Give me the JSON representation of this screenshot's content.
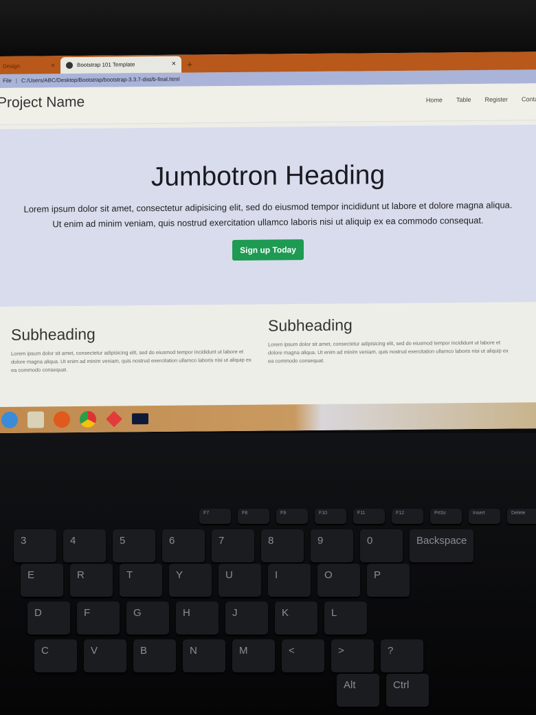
{
  "browser": {
    "tabs": [
      {
        "label": "Design",
        "active": false
      },
      {
        "label": "Bootstrap 101 Template",
        "active": true
      }
    ],
    "new_tab": "+",
    "close": "×",
    "address": {
      "scheme": "File",
      "url": "C:/Users/ABC/Desktop/Bootstrap/bootstrap-3.3.7-dist/b-final.html"
    }
  },
  "navbar": {
    "brand": "Project Name",
    "links": [
      "Home",
      "Table",
      "Register",
      "Contact"
    ]
  },
  "jumbotron": {
    "heading": "Jumbotron Heading",
    "text": "Lorem ipsum dolor sit amet, consectetur adipisicing elit, sed do eiusmod tempor incididunt ut labore et dolore magna aliqua. Ut enim ad minim veniam, quis nostrud exercitation ullamco laboris nisi ut aliquip ex ea commodo consequat.",
    "button": "Sign up Today",
    "button_color": "#1e9a52"
  },
  "sections": [
    {
      "heading": "Subheading",
      "text": "Lorem ipsum dolor sit amet, consectetur adipisicing elit, sed do eiusmod tempor incididunt ut labore et dolore magna aliqua. Ut enim ad minim veniam, quis nostrud exercitation ullamco laboris nisi ut aliquip ex ea commodo consequat."
    },
    {
      "heading": "Subheading",
      "text": "Lorem ipsum dolor sit amet, consectetur adipisicing elit, sed do eiusmod tempor incididunt ut labore et dolore magna aliqua. Ut enim ad minim veniam, quis nostrud exercitation ullamco laboris nisi ut aliquip ex ea commodo consequat."
    }
  ],
  "taskbar": {
    "icons": [
      "internet-explorer-icon",
      "file-explorer-icon",
      "firefox-icon",
      "chrome-icon",
      "app-icon",
      "command-prompt-icon"
    ]
  },
  "keyboard": {
    "fkeys": [
      "F7",
      "F8",
      "F9",
      "F10",
      "F11",
      "F12",
      "PrtSc",
      "Insert",
      "Delete"
    ],
    "row1": [
      "3",
      "4",
      "5",
      "6",
      "7",
      "8",
      "9",
      "0",
      "Backspace"
    ],
    "row2": [
      "E",
      "R",
      "T",
      "Y",
      "U",
      "I",
      "O",
      "P"
    ],
    "row3": [
      "D",
      "F",
      "G",
      "H",
      "J",
      "K",
      "L"
    ],
    "row4": [
      "C",
      "V",
      "B",
      "N",
      "M",
      "<",
      ">",
      "?"
    ],
    "row5": [
      "Alt",
      "Ctrl"
    ]
  }
}
